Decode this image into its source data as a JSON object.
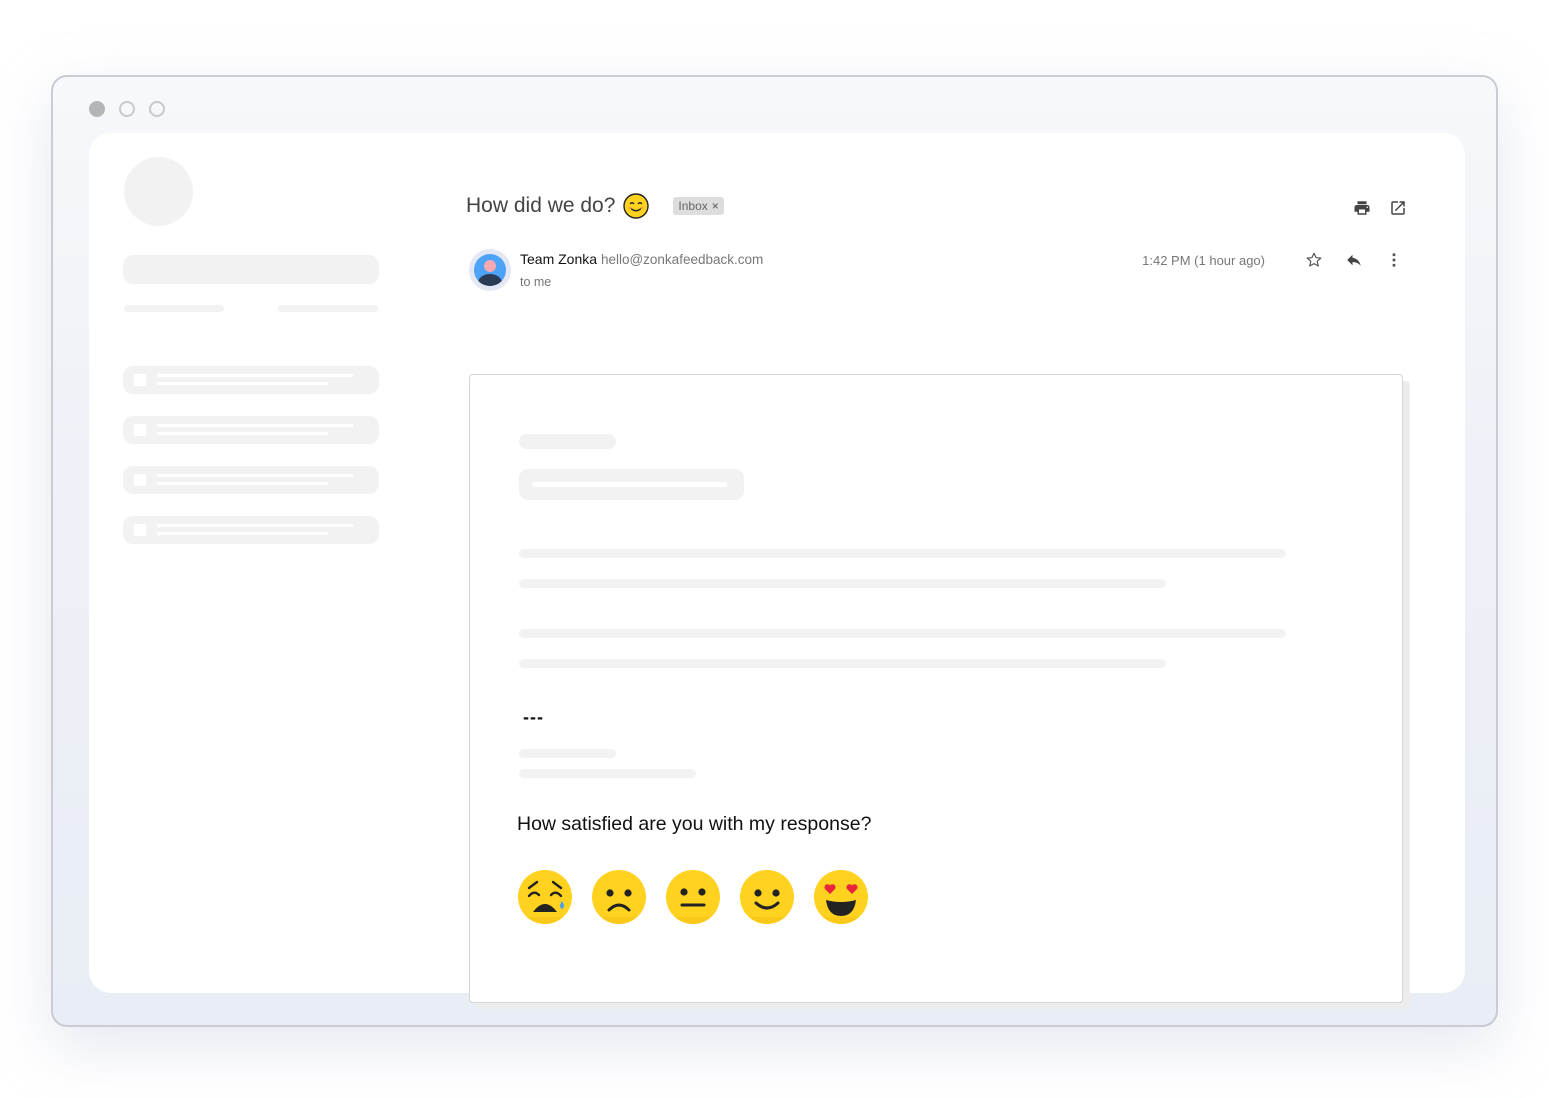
{
  "window": {
    "controls": [
      "close",
      "minimize",
      "maximize"
    ]
  },
  "email": {
    "subject": "How did we do?",
    "subject_emoji": "smiling-face-icon",
    "label": "Inbox",
    "label_remove": "×",
    "toolbar": {
      "print_icon": "print-icon",
      "open_new_window_icon": "open-in-new-icon"
    },
    "sender_name": "Team Zonka",
    "sender_email": "hello@zonkafeedback.com",
    "recipient": "to me",
    "timestamp": "1:42 PM (1 hour ago)",
    "actions": [
      "star-icon",
      "reply-icon",
      "more-vert-icon"
    ],
    "signature_separator": "---",
    "survey": {
      "question": "How satisfied are you with my response?",
      "options": [
        {
          "name": "very-dissatisfied",
          "emoji": "weary-crying-face"
        },
        {
          "name": "dissatisfied",
          "emoji": "frowning-face"
        },
        {
          "name": "neutral",
          "emoji": "neutral-face"
        },
        {
          "name": "satisfied",
          "emoji": "slightly-smiling-face"
        },
        {
          "name": "very-satisfied",
          "emoji": "heart-eyes-face"
        }
      ]
    }
  },
  "colors": {
    "emoji_yellow": "#FFD21F",
    "avatar_blue": "#4DA3F5",
    "avatar_ring": "#E4E8F4",
    "skeleton": "#F2F2F2"
  }
}
